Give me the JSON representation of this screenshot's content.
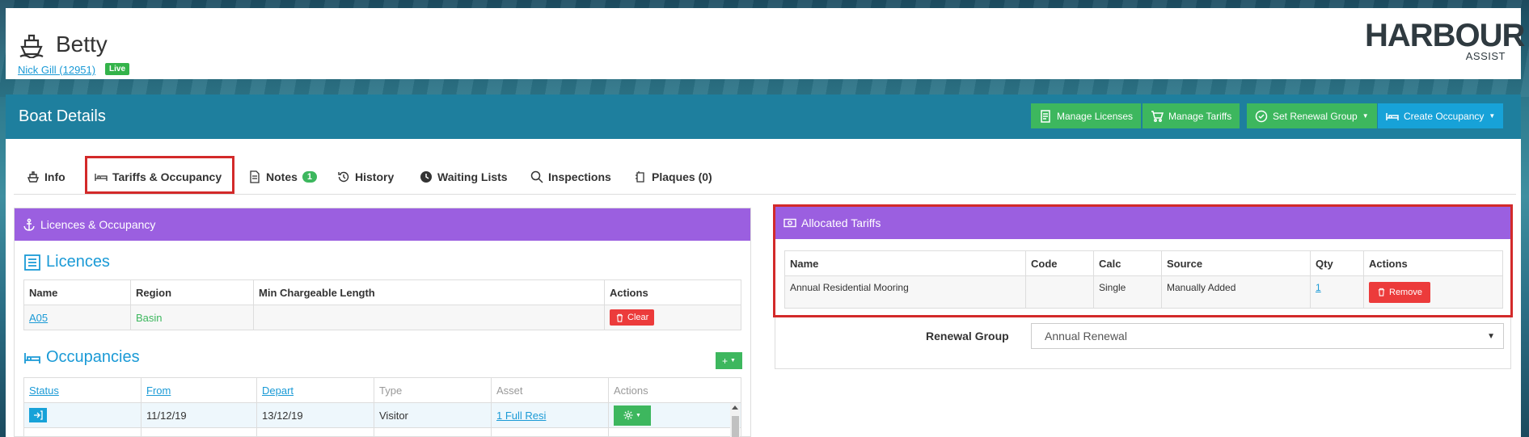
{
  "boat": {
    "name": "Betty",
    "owner_link": "Nick Gill (12951)",
    "status_badge": "Live"
  },
  "logo": {
    "line1": "HARBOUR",
    "line2": "ASSIST"
  },
  "header": {
    "title": "Boat Details",
    "buttons": [
      "Manage Licenses",
      "Manage Tariffs",
      "Set Renewal Group",
      "Create Occupancy"
    ]
  },
  "tabs": [
    {
      "label": "Info"
    },
    {
      "label": "Tariffs & Occupancy"
    },
    {
      "label": "Notes",
      "count": "1"
    },
    {
      "label": "History"
    },
    {
      "label": "Waiting Lists"
    },
    {
      "label": "Inspections"
    },
    {
      "label": "Plaques (0)"
    }
  ],
  "left_panel": {
    "title": "Licences & Occupancy",
    "licences_title": "Licences",
    "licences_columns": [
      "Name",
      "Region",
      "Min Chargeable Length",
      "Actions"
    ],
    "licences_rows": [
      {
        "name": "A05",
        "region": "Basin",
        "min_length": "",
        "action": "Clear"
      }
    ],
    "occupancies_title": "Occupancies",
    "occupancies_columns": [
      "Status",
      "From",
      "Depart",
      "Type",
      "Asset",
      "Actions"
    ],
    "occupancies_rows": [
      {
        "from": "11/12/19",
        "depart": "13/12/19",
        "type": "Visitor",
        "asset": "1 Full Resi"
      }
    ]
  },
  "right_panel": {
    "title": "Allocated Tariffs",
    "columns": [
      "Name",
      "Code",
      "Calc",
      "Source",
      "Qty",
      "Actions"
    ],
    "rows": [
      {
        "name": "Annual Residential Mooring",
        "code": "",
        "calc": "Single",
        "source": "Manually Added",
        "qty": "1",
        "action": "Remove"
      }
    ],
    "renewal_group_label": "Renewal Group",
    "renewal_group_value": "Annual Renewal"
  },
  "colors": {
    "header_bar": "#1e7f9e",
    "panel_header": "#9b5fe0",
    "green_button": "#3db75e",
    "blue_button": "#17a2d8",
    "danger": "#ec3b3b",
    "highlight": "#d32a2a"
  }
}
